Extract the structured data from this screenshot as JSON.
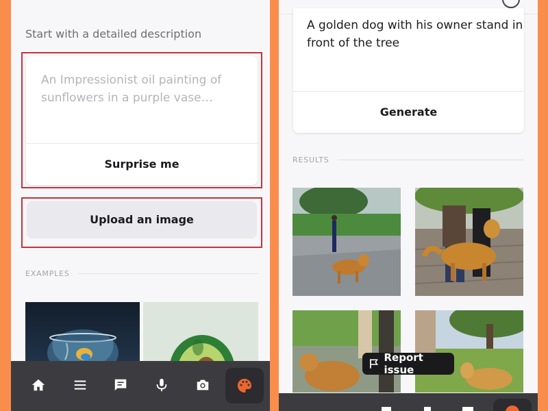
{
  "left_screen": {
    "prompt_label": "Start with a detailed description",
    "prompt_placeholder": "An Impressionist oil painting of sunflowers in a purple vase…",
    "surprise_button": "Surprise me",
    "upload_button": "Upload an image",
    "examples_label": "EXAMPLES",
    "examples": [
      {
        "subject": "fishbowl-with-goldfish"
      },
      {
        "subject": "avocado-plush-chair"
      }
    ],
    "bottom_nav": [
      {
        "icon": "home-icon"
      },
      {
        "icon": "menu-icon"
      },
      {
        "icon": "chat-icon"
      },
      {
        "icon": "mic-icon"
      },
      {
        "icon": "camera-icon"
      },
      {
        "icon": "palette-icon",
        "active": true
      }
    ]
  },
  "right_screen": {
    "prompt_text": "A golden dog with his owner stand in front of the tree",
    "generate_button": "Generate",
    "results_label": "RESULTS",
    "results": [
      {
        "subject": "golden-dog-and-owner-near-tree"
      },
      {
        "subject": "golden-dog-beside-owner-on-boardwalk"
      },
      {
        "subject": "golden-dog-by-tree-trunk"
      },
      {
        "subject": "golden-dog-on-grass-park"
      }
    ],
    "report_button": "Report issue"
  },
  "colors": {
    "frame": "#F98D4C",
    "highlight": "#C8313A",
    "nav_bar": "#3C3C40",
    "active_icon": "#F0652E"
  }
}
